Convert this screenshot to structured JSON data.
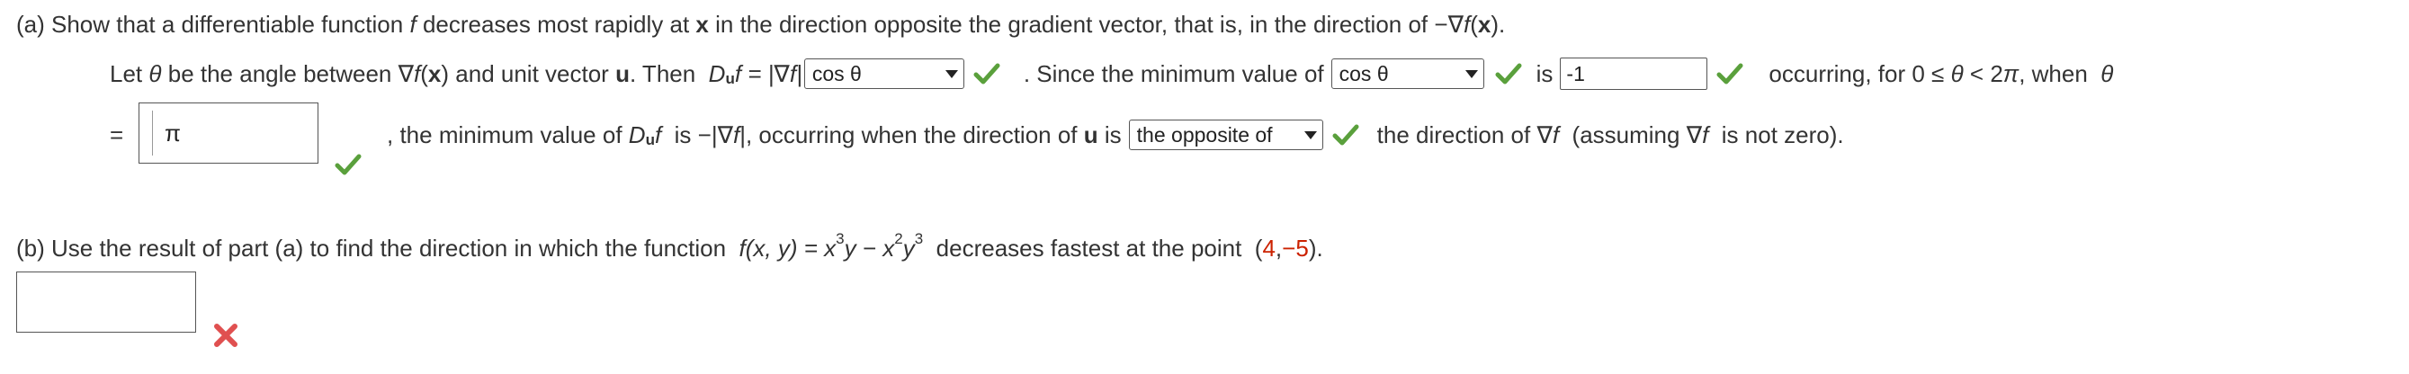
{
  "part_a": {
    "intro": "(a) Show that a differentiable function",
    "f": "f",
    "intro2": "decreases most rapidly at",
    "x": "x",
    "intro3": "in the direction opposite the gradient vector, that is, in the direction of −∇",
    "intro3_f": "f",
    "intro3_paren_open": "(",
    "intro3_x": "x",
    "intro3_end": ").",
    "let_text": "Let",
    "theta": "θ",
    "be_angle": "be the angle between ∇",
    "grad_f": "f",
    "grad_x_open": "(",
    "grad_x": "x",
    "grad_close": ") and unit vector",
    "u": "u",
    "then": ". Then",
    "D": "D",
    "D_sub": "u",
    "D_f_eq": "f = |∇",
    "D_f2": "f|",
    "select1_value": "cos θ",
    "since": ". Since the minimum value of",
    "select2_value": "cos θ",
    "is": "is",
    "input1_value": "-1",
    "occurring": "occurring, for 0 ≤",
    "occ_theta": "θ",
    "occ_mid": "< 2",
    "occ_pi": "π",
    "occ_when": ", when",
    "occ_theta2": "θ",
    "eq_sign": "=",
    "input2_value": "π",
    "min_text": ", the minimum value of",
    "min_D": "D",
    "min_D_sub": "u",
    "min_f": "f",
    "min_is": "is −|∇",
    "min_f2": "f",
    "min_occ": "|, occurring when the direction of",
    "min_u": "u",
    "min_is2": "is",
    "select3_value": "the opposite of",
    "dir_text": "the direction of ∇",
    "dir_f": "f",
    "assume": "(assuming ∇",
    "assume_f": "f",
    "assume_end": "is not zero)."
  },
  "part_b": {
    "text": "(b) Use the result of part (a) to find the direction in which the function",
    "func_f": "f",
    "func_args": "(x, y) = x",
    "exp1": "3",
    "y1": "y − x",
    "exp2": "2",
    "y2": "y",
    "exp3": "3",
    "decreases": "decreases fastest at the point",
    "pt_open": "(",
    "pt_x": "4",
    "pt_comma": ", ",
    "pt_y": "−5",
    "pt_close": ").",
    "answer_value": ""
  },
  "colors": {
    "check": "#5aa03c",
    "x_mark": "#e05050",
    "point": "#cc2200"
  },
  "icons": {
    "correct": "check-icon",
    "incorrect": "x-mark-icon"
  }
}
